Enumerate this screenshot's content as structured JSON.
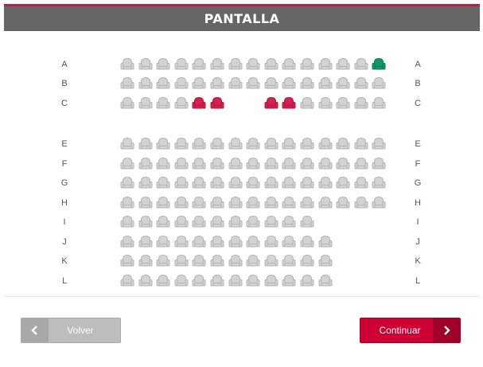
{
  "screen": {
    "label": "PANTALLA",
    "accent_color": "#d0173f",
    "bar_color": "#666666"
  },
  "legend_colors": {
    "available": "#d3d3d3",
    "occupied": "#d6204f",
    "selected": "#0e9a6b"
  },
  "rows": [
    {
      "label": "A",
      "seats": [
        "a",
        "a",
        "a",
        "a",
        "a",
        "a",
        "a",
        "a",
        "a",
        "a",
        "a",
        "a",
        "a",
        "a",
        "s"
      ]
    },
    {
      "label": "B",
      "seats": [
        "a",
        "a",
        "a",
        "a",
        "a",
        "a",
        "a",
        "a",
        "a",
        "a",
        "a",
        "a",
        "a",
        "a",
        "a"
      ]
    },
    {
      "label": "C",
      "seats": [
        "a",
        "a",
        "a",
        "a",
        "o",
        "o",
        "_",
        "_",
        "o",
        "o",
        "a",
        "a",
        "a",
        "a",
        "a"
      ]
    },
    {
      "label": "E",
      "seats": [
        "a",
        "a",
        "a",
        "a",
        "a",
        "a",
        "a",
        "a",
        "a",
        "a",
        "a",
        "a",
        "a",
        "a",
        "a"
      ]
    },
    {
      "label": "F",
      "seats": [
        "a",
        "a",
        "a",
        "a",
        "a",
        "a",
        "a",
        "a",
        "a",
        "a",
        "a",
        "a",
        "a",
        "a",
        "a"
      ]
    },
    {
      "label": "G",
      "seats": [
        "a",
        "a",
        "a",
        "a",
        "a",
        "a",
        "a",
        "a",
        "a",
        "a",
        "a",
        "a",
        "a",
        "a",
        "a"
      ]
    },
    {
      "label": "H",
      "seats": [
        "a",
        "a",
        "a",
        "a",
        "a",
        "a",
        "a",
        "a",
        "a",
        "a",
        "a",
        "a",
        "a",
        "a",
        "a"
      ]
    },
    {
      "label": "I",
      "seats": [
        "a",
        "a",
        "a",
        "a",
        "a",
        "a",
        "a",
        "a",
        "a",
        "a",
        "a"
      ]
    },
    {
      "label": "J",
      "seats": [
        "a",
        "a",
        "a",
        "a",
        "a",
        "a",
        "a",
        "a",
        "a",
        "a",
        "a",
        "a"
      ]
    },
    {
      "label": "K",
      "seats": [
        "a",
        "a",
        "a",
        "a",
        "a",
        "a",
        "a",
        "a",
        "a",
        "a",
        "a",
        "a"
      ]
    },
    {
      "label": "L",
      "seats": [
        "a",
        "a",
        "a",
        "a",
        "a",
        "a",
        "a",
        "a",
        "a",
        "a",
        "a",
        "a"
      ]
    }
  ],
  "buttons": {
    "back_label": "Volver",
    "back_icon": "chevron-left-icon",
    "next_label": "Continuar",
    "next_icon": "chevron-right-icon",
    "next_color": "#cc0033"
  }
}
